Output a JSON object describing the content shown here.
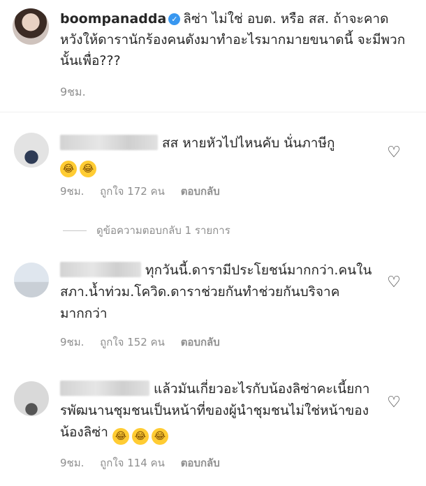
{
  "post": {
    "username": "boompanadda",
    "caption": "ลิซ่า ไม่ใช่ อบต. หรือ สส. ถ้าจะคาดหวังให้ดารานักร้องคนดังมาทำอะไรมากมายขนาดนี้ จะมีพวกนั้นเพื่อ???",
    "time": "9ชม."
  },
  "view_replies": "ดูข้อความตอบกลับ 1 รายการ",
  "comments": [
    {
      "text": "สส หายหัวไปไหนคับ  นั่นภาษีกู",
      "emojis": "😂😂",
      "time": "9ชม.",
      "likes": "ถูกใจ 172 คน",
      "reply": "ตอบกลับ"
    },
    {
      "text": "ทุกวันนี้.ดารามีประโยชน์มากกว่า.คนในสภา.น้ำท่วม.โควิด.ดาราช่วยกันทำช่วยกันบริจาคมากกว่า",
      "time": "9ชม.",
      "likes": "ถูกใจ 152 คน",
      "reply": "ตอบกลับ"
    },
    {
      "text": "แล้วมันเกี่ยวอะไรกับน้องลิซ่าคะเนี้ยการพัฒนานชุมชนเป็นหน้าที่ของผู้นำชุมชนไม่ใช่หน้าของน้องลิซ่า",
      "emojis": "😂😂😂",
      "time": "9ชม.",
      "likes": "ถูกใจ 114 คน",
      "reply": "ตอบกลับ"
    }
  ],
  "icons": {
    "heart": "heart-outline-icon",
    "verified": "verified-badge-icon"
  },
  "colors": {
    "text": "#262626",
    "secondary": "#8e8e8e",
    "verified": "#3897f0"
  }
}
